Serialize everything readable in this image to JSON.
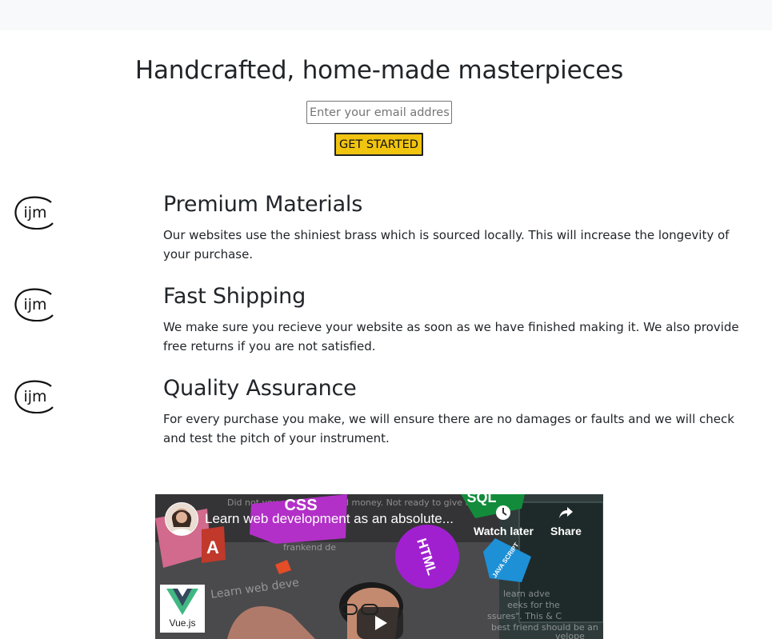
{
  "hero": {
    "title": "Handcrafted, home-made masterpieces",
    "email_placeholder": "Enter your email address",
    "cta_label": "GET STARTED"
  },
  "features": [
    {
      "logo_icon": "ijm-logo-icon",
      "title": "Premium Materials",
      "text": "Our websites use the shiniest brass which is sourced locally. This will increase the longevity of your purchase."
    },
    {
      "logo_icon": "ijm-logo-icon",
      "title": "Fast Shipping",
      "text": "We make sure you recieve your website as soon as we have finished making it. We also provide free returns if you are not satisfied."
    },
    {
      "logo_icon": "ijm-logo-icon",
      "title": "Quality Assurance",
      "text": "For every purchase you make, we will ensure there are no damages or faults and we will check and test the pitch of your instrument."
    }
  ],
  "logo_text": "ijm",
  "video": {
    "title": "Learn web development as an absolute...",
    "watch_later_label": "Watch later",
    "share_label": "Share",
    "channel_logo_label": "Vue.js",
    "thumbnail_tags": [
      "CSS",
      "HTML",
      "JAVA SCRIPT",
      "SQL"
    ],
    "thumbnail_background_text": [
      "Did not you",
      "d money. Not ready to give up",
      "Learn web deve",
      "frankend de",
      "learn adve",
      "eeks for the",
      "ssures\". This & C",
      "best friend should be an",
      "velope"
    ]
  },
  "colors": {
    "cta_background": "#f1c40f",
    "topbar_background": "#f8f9fa",
    "text": "#212529"
  }
}
